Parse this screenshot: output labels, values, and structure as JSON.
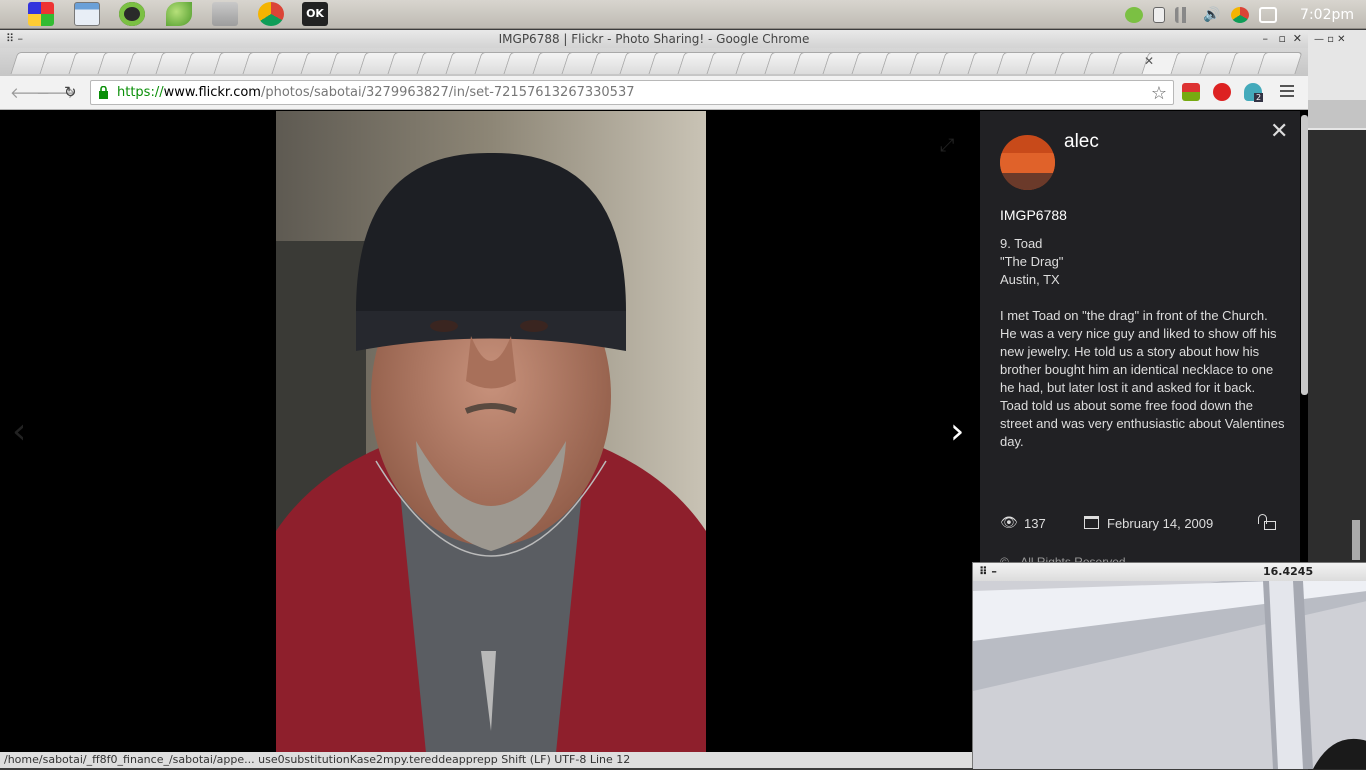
{
  "panel": {
    "clock": "7:02pm",
    "launchers": [
      "windows-logo-icon",
      "file-manager-window-icon",
      "spotify-icon",
      "leaf-app-icon",
      "folder-icon",
      "chrome-icon",
      "ok-app-icon"
    ]
  },
  "window": {
    "title": "IMGP6788 | Flickr - Photo Sharing! - Google Chrome"
  },
  "omnibox": {
    "scheme": "https://",
    "host": "www.flickr.com",
    "path": "/photos/sabotai/3279963827/in/set-72157613267330537"
  },
  "extensions": {
    "badge": "2"
  },
  "sidebar": {
    "username": "alec",
    "photo_title": "IMGP6788",
    "description_lines": [
      "9. Toad",
      "\"The Drag\"",
      "Austin, TX"
    ],
    "description_body": "I met Toad on \"the drag\" in front of the Church. He was a very nice guy and liked to show off his new jewelry. He told us a story about how his brother bought him an identical necklace to one he had, but later lost it and asked for it back. Toad told us about some free food down the street and was very enthusiastic about Valentines day.",
    "views": "137",
    "date": "February 14, 2009",
    "license": "All Rights Reserved"
  },
  "webcam": {
    "value": "16.4245"
  },
  "bottom_strip": {
    "text": "/home/sabotai/_ff8f0_finance_/sabotai/appe... use0substitutionKase2mpy.tereddeapprepp      Shift (LF)      UTF-8      Line 12"
  }
}
